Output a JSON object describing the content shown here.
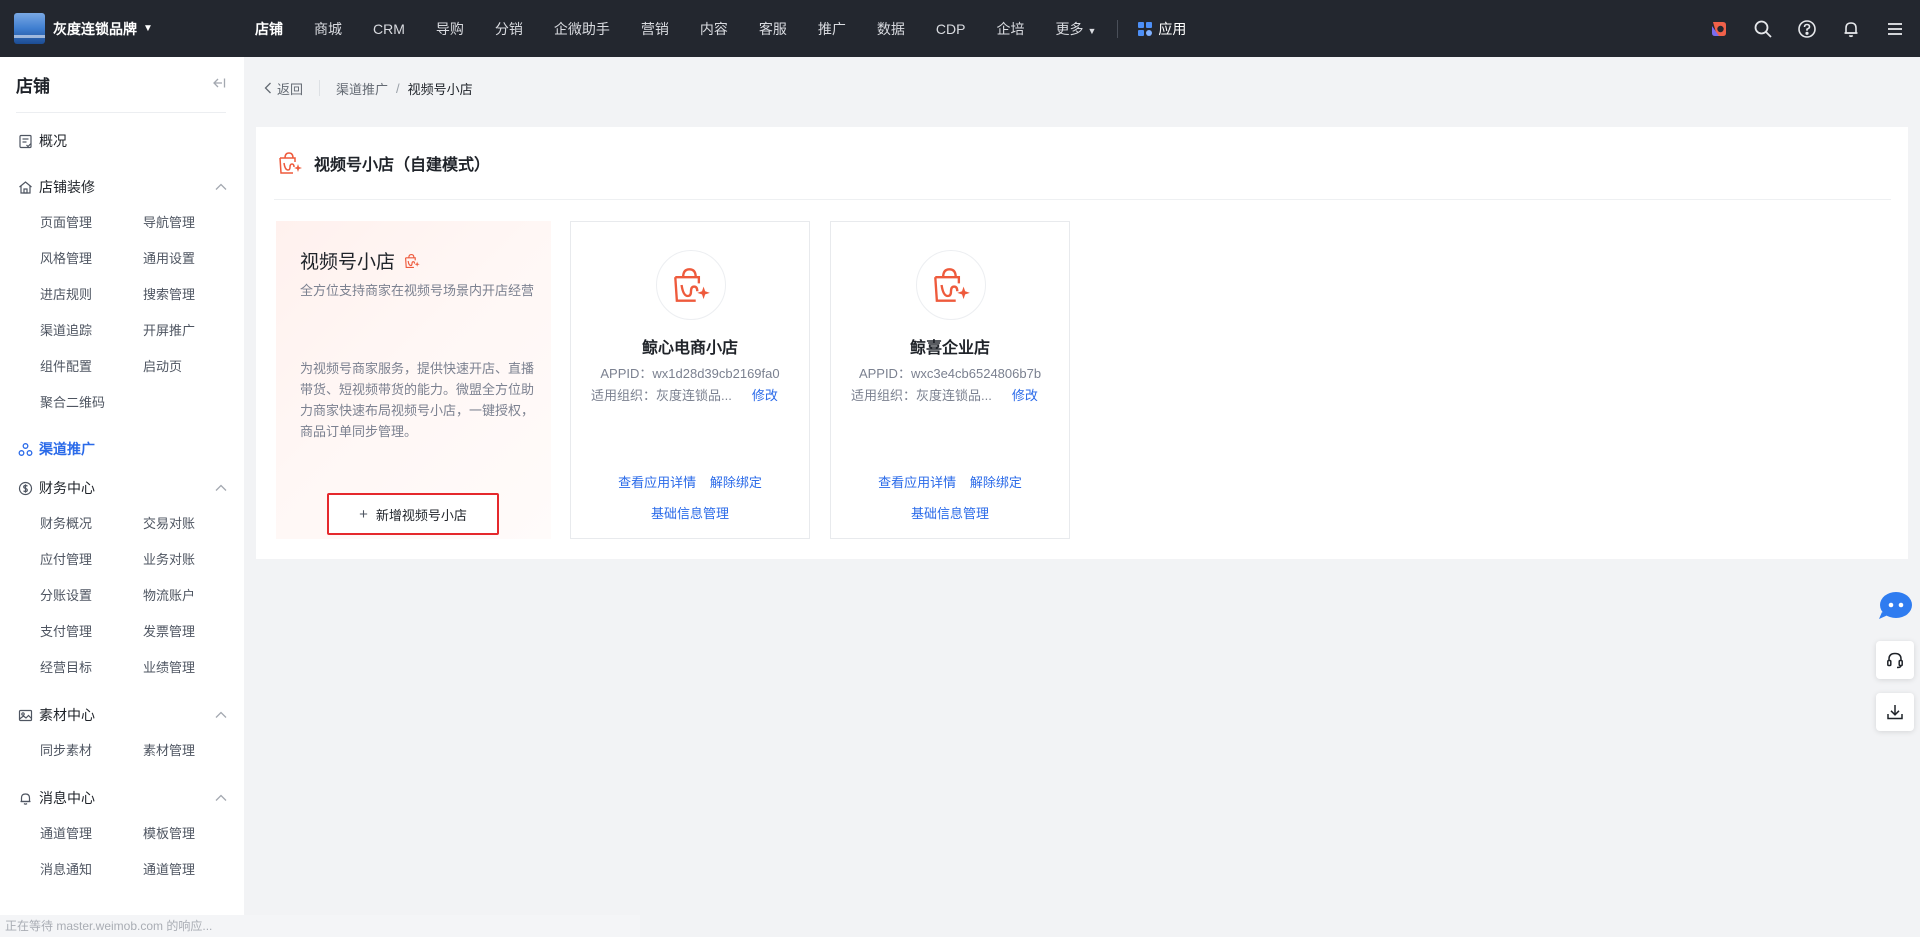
{
  "topbar": {
    "brand": "灰度连锁品牌",
    "nav": [
      {
        "label": "店铺",
        "active": true
      },
      {
        "label": "商城"
      },
      {
        "label": "CRM"
      },
      {
        "label": "导购"
      },
      {
        "label": "分销"
      },
      {
        "label": "企微助手"
      },
      {
        "label": "营销"
      },
      {
        "label": "内容"
      },
      {
        "label": "客服"
      },
      {
        "label": "推广"
      },
      {
        "label": "数据"
      },
      {
        "label": "CDP"
      },
      {
        "label": "企培"
      },
      {
        "label": "更多"
      }
    ],
    "app_label": "应用",
    "right_icons": [
      "brand-app-icon",
      "search-icon",
      "help-icon",
      "bell-icon",
      "menu-icon"
    ]
  },
  "sidebar": {
    "title": "店铺",
    "overview": "概况",
    "groups": [
      {
        "label": "店铺装修",
        "items": [
          "页面管理",
          "导航管理",
          "风格管理",
          "通用设置",
          "进店规则",
          "搜索管理",
          "渠道追踪",
          "开屏推广",
          "组件配置",
          "启动页",
          "聚合二维码"
        ]
      },
      {
        "label": "渠道推广",
        "active": true,
        "items": []
      },
      {
        "label": "财务中心",
        "items": [
          "财务概况",
          "交易对账",
          "应付管理",
          "业务对账",
          "分账设置",
          "物流账户",
          "支付管理",
          "发票管理",
          "经营目标",
          "业绩管理"
        ]
      },
      {
        "label": "素材中心",
        "items": [
          "同步素材",
          "素材管理"
        ]
      },
      {
        "label": "消息中心",
        "items": [
          "通道管理",
          "模板管理",
          "消息通知",
          "通道管理"
        ]
      }
    ]
  },
  "status_text": "正在等待 master.weimob.com 的响应...",
  "breadcrumb": {
    "back": "返回",
    "parent": "渠道推广",
    "separator": "/",
    "current": "视频号小店"
  },
  "panel": {
    "title": "视频号小店（自建模式）",
    "intro": {
      "title": "视频号小店",
      "subtitle": "全方位支持商家在视频号场景内开店经营",
      "description": "为视频号商家服务，提供快速开店、直播带货、短视频带货的能力。微盟全方位助力商家快速布局视频号小店，一键授权，商品订单同步管理。",
      "add_button": "新增视频号小店"
    },
    "shops": [
      {
        "name": "鲸心电商小店",
        "appid": "APPID：wx1d28d39cb2169fa0",
        "org": "适用组织：灰度连锁品...",
        "edit": "修改",
        "detail_link": "查看应用详情",
        "unbind_link": "解除绑定",
        "info_link": "基础信息管理"
      },
      {
        "name": "鲸喜企业店",
        "appid": "APPID：wxc3e4cb6524806b7b",
        "org": "适用组织：灰度连锁品...",
        "edit": "修改",
        "detail_link": "查看应用详情",
        "unbind_link": "解除绑定",
        "info_link": "基础信息管理"
      }
    ]
  },
  "colors": {
    "topbar_bg": "#23272f",
    "accent_blue": "#2a6ae9",
    "shop_red": "#ee5a3c",
    "highlight_red": "#e5282c"
  }
}
